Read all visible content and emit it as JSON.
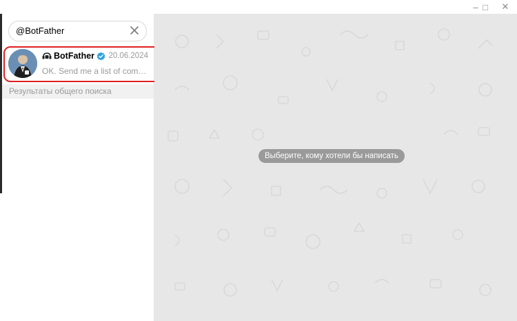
{
  "window": {
    "controls": [
      {
        "name": "minimize",
        "glyph": "–"
      },
      {
        "name": "maximize",
        "glyph": "□"
      },
      {
        "name": "close",
        "glyph": "✕"
      }
    ]
  },
  "search": {
    "value": "@BotFather"
  },
  "results": [
    {
      "name": "BotFather",
      "date": "20.06.2024",
      "preview": "OK. Send me a list of commands for your bot"
    }
  ],
  "global_search_header": "Результаты общего поиска",
  "chat": {
    "empty_hint": "Выберите, кому хотели бы написать"
  },
  "colors": {
    "accent": "#2aa3e0",
    "highlight": "#e02020",
    "chat_bg": "#e7e7e7"
  }
}
